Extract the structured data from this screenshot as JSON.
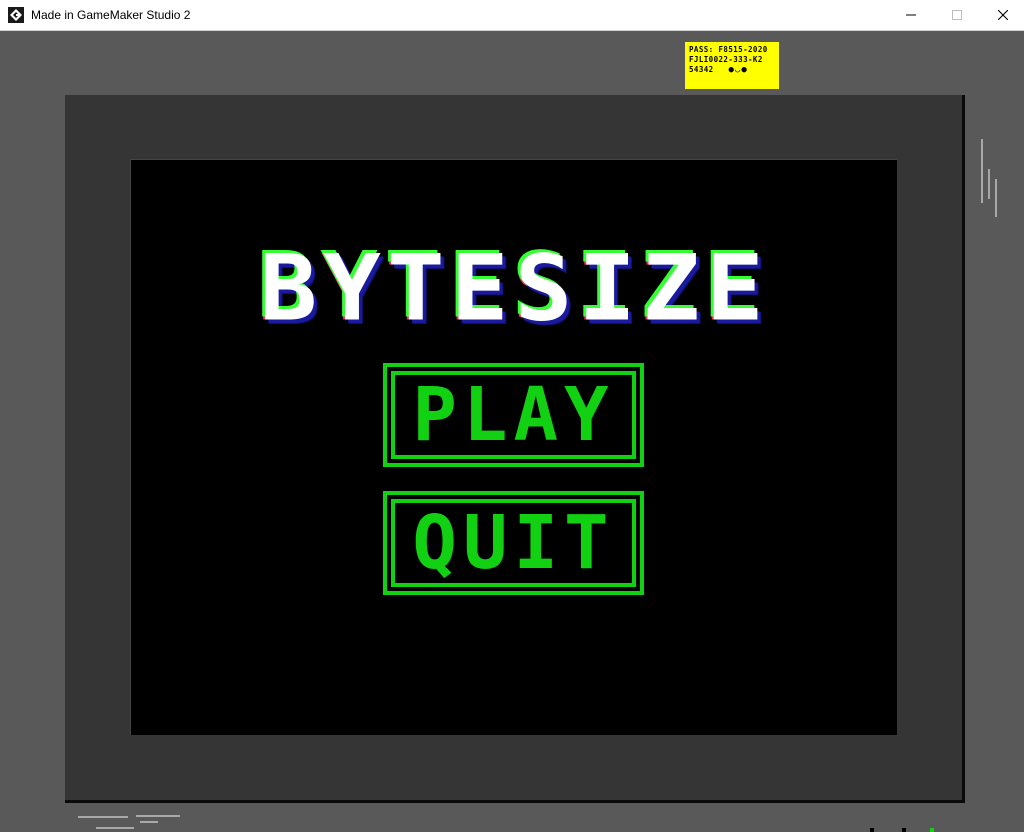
{
  "window": {
    "title": "Made in GameMaker Studio 2"
  },
  "pass": {
    "line1": "PASS: F8515-2020",
    "line2": "FJLI0022-333-K2",
    "line3": "54342",
    "dots": "●◡●"
  },
  "game": {
    "title": "BYTESIZE",
    "play_label": "PLAY",
    "quit_label": "QUIT"
  },
  "colors": {
    "accent_green": "#12d012",
    "pass_yellow": "#ffff00",
    "background": "#595959",
    "monitor": "#353535"
  }
}
